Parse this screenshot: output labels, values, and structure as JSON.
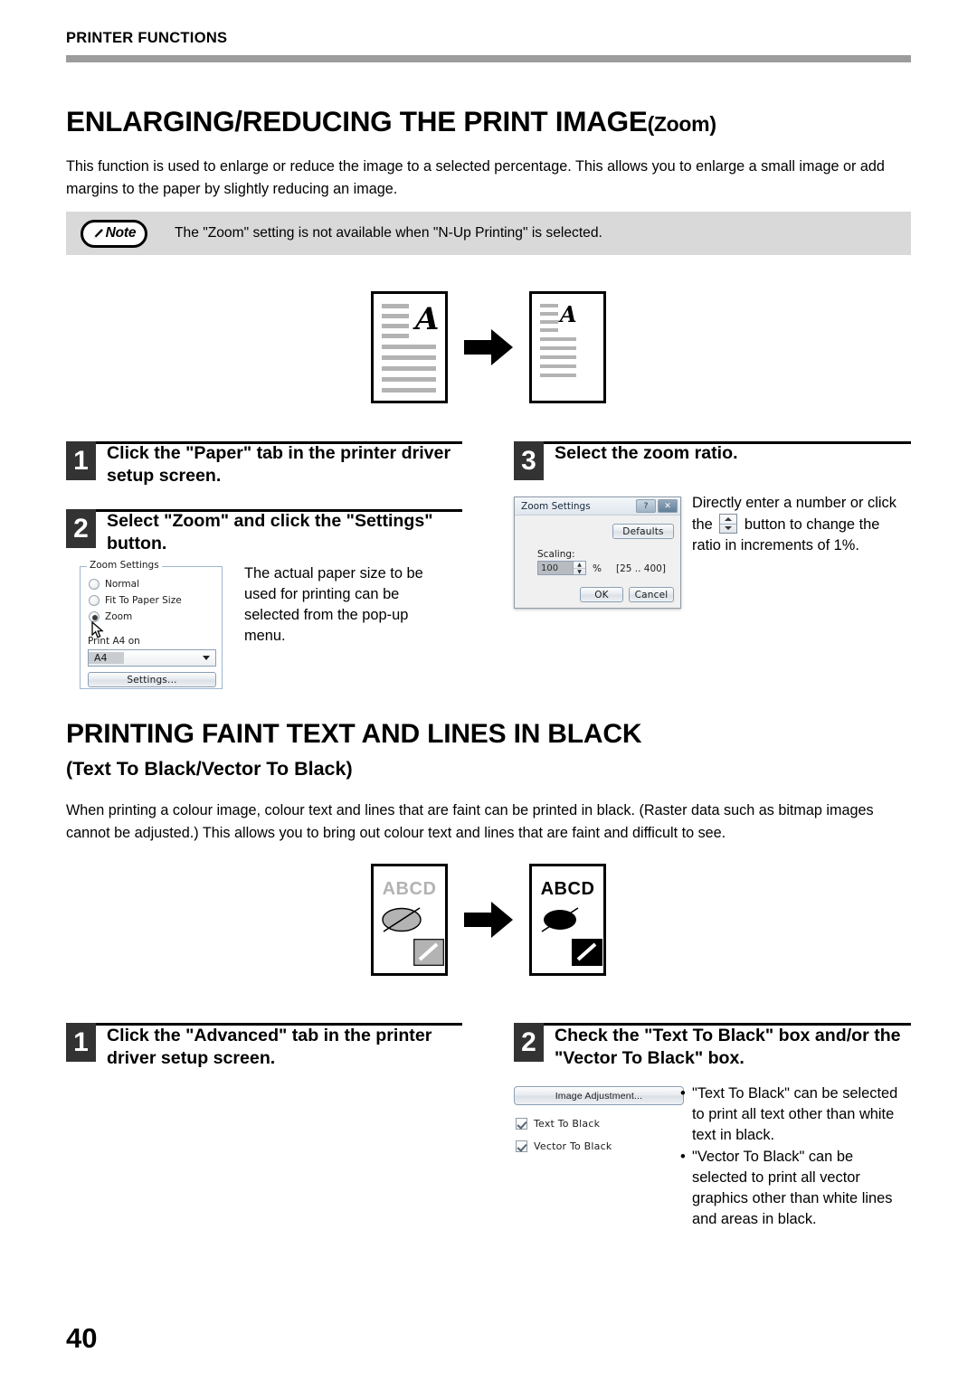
{
  "header": {
    "running_title": "PRINTER FUNCTIONS"
  },
  "section_zoom": {
    "heading_main": "ENLARGING/REDUCING THE PRINT IMAGE",
    "heading_suffix": "(Zoom)",
    "intro": "This function is used to enlarge or reduce the image to a selected percentage. This allows you to enlarge a small image or add margins to the paper by slightly reducing an image.",
    "note": {
      "label": "Note",
      "text": "The \"Zoom\" setting is not available when \"N-Up Printing\" is selected."
    },
    "steps": [
      {
        "number": "1",
        "title": "Click the \"Paper\" tab in the printer driver setup screen."
      },
      {
        "number": "2",
        "title": "Select \"Zoom\" and click the \"Settings\" button.",
        "description": "The actual paper size to be used for printing can be selected from the pop-up menu."
      },
      {
        "number": "3",
        "title": "Select the zoom ratio.",
        "description_pre": "Directly enter a number or click the",
        "description_post": "button to change the ratio in increments of 1%."
      }
    ],
    "zoom_settings_group": {
      "legend": "Zoom Settings",
      "radios": [
        {
          "label": "Normal",
          "selected": false
        },
        {
          "label": "Fit To Paper Size",
          "selected": false
        },
        {
          "label": "Zoom",
          "selected": true
        }
      ],
      "combo_label": "Print A4 on",
      "combo_value": "A4",
      "settings_button": "Settings..."
    },
    "zoom_dialog": {
      "title": "Zoom Settings",
      "help_glyph": "?",
      "close_glyph": "✕",
      "defaults_button": "Defaults",
      "scaling_label": "Scaling:",
      "scaling_value": "100",
      "percent_symbol": "%",
      "range_text": "[25 .. 400]",
      "ok_button": "OK",
      "cancel_button": "Cancel"
    }
  },
  "section_black": {
    "heading_main": "PRINTING FAINT TEXT AND LINES IN BLACK",
    "heading_sub": "(Text To Black/Vector To Black)",
    "intro": "When printing a colour image, colour text and lines that are faint can be printed in black. (Raster data such as bitmap images cannot be adjusted.) This allows you to bring out colour text and lines that are faint and difficult to see.",
    "illustration": {
      "before_label": "ABCD",
      "after_label": "ABCD"
    },
    "steps": [
      {
        "number": "1",
        "title": "Click the \"Advanced\" tab in the printer driver setup screen."
      },
      {
        "number": "2",
        "title": "Check the \"Text To Black\" box and/or the \"Vector To Black\" box."
      }
    ],
    "advanced_panel": {
      "image_adjustment_button": "Image Adjustment...",
      "checkboxes": [
        {
          "label": "Text To Black",
          "checked": true
        },
        {
          "label": "Vector To Black",
          "checked": true
        }
      ]
    },
    "bullets": [
      "\"Text To Black\" can be selected to print all text other than white text in black.",
      "\"Vector To Black\" can be selected to print all vector graphics other than white lines and areas in black."
    ]
  },
  "footer": {
    "page_number": "40"
  },
  "colors": {
    "rule_gray": "#9c9c9c",
    "note_background": "#d9d9d9",
    "step_number_background": "#333333",
    "faint_gray": "#b3b3b3"
  }
}
